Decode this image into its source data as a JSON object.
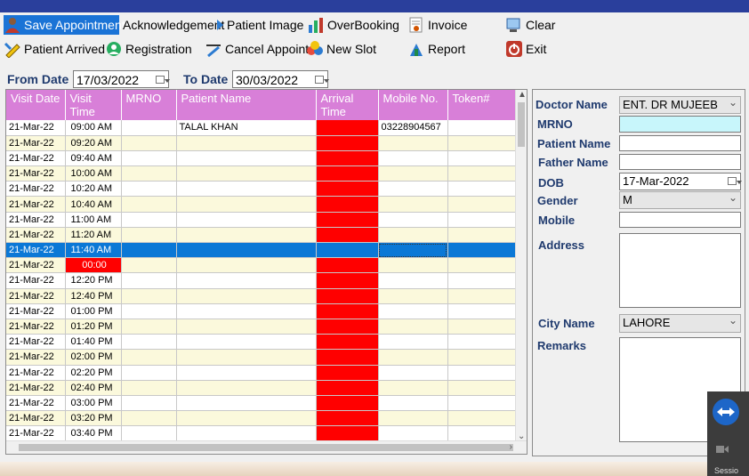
{
  "toolbar": {
    "save_appointment": "Save Appointment",
    "acknowledgement": "Acknowledgement",
    "patient_image": "Patient Image",
    "overbooking": "OverBooking",
    "invoice": "Invoice",
    "clear": "Clear",
    "patient_arrived": "Patient Arrived",
    "registration": "Registration",
    "cancel_appoint": "Cancel Appoint",
    "new_slot": "New Slot",
    "report": "Report",
    "exit": "Exit"
  },
  "filters": {
    "from_label": "From Date",
    "from_value": "17/03/2022",
    "to_label": "To Date",
    "to_value": "30/03/2022"
  },
  "grid": {
    "columns": [
      "Visit Date",
      "Visit Time",
      "MRNO",
      "Patient Name",
      "Arrival Time",
      "Mobile No.",
      "Token#"
    ],
    "rows": [
      {
        "date": "21-Mar-22",
        "time": "09:00 AM",
        "mrno": "",
        "name": "TALAL KHAN",
        "arrival": "",
        "mobile": "03228904567",
        "token": ""
      },
      {
        "date": "21-Mar-22",
        "time": "09:20 AM",
        "mrno": "",
        "name": "",
        "arrival": "",
        "mobile": "",
        "token": ""
      },
      {
        "date": "21-Mar-22",
        "time": "09:40 AM",
        "mrno": "",
        "name": "",
        "arrival": "",
        "mobile": "",
        "token": ""
      },
      {
        "date": "21-Mar-22",
        "time": "10:00 AM",
        "mrno": "",
        "name": "",
        "arrival": "",
        "mobile": "",
        "token": ""
      },
      {
        "date": "21-Mar-22",
        "time": "10:20 AM",
        "mrno": "",
        "name": "",
        "arrival": "",
        "mobile": "",
        "token": ""
      },
      {
        "date": "21-Mar-22",
        "time": "10:40 AM",
        "mrno": "",
        "name": "",
        "arrival": "",
        "mobile": "",
        "token": ""
      },
      {
        "date": "21-Mar-22",
        "time": "11:00 AM",
        "mrno": "",
        "name": "",
        "arrival": "",
        "mobile": "",
        "token": ""
      },
      {
        "date": "21-Mar-22",
        "time": "11:20 AM",
        "mrno": "",
        "name": "",
        "arrival": "",
        "mobile": "",
        "token": ""
      },
      {
        "date": "21-Mar-22",
        "time": "11:40 AM",
        "mrno": "",
        "name": "",
        "arrival": "",
        "mobile": "",
        "token": ""
      },
      {
        "date": "21-Mar-22",
        "time": "00:00",
        "mrno": "",
        "name": "",
        "arrival": "",
        "mobile": "",
        "token": ""
      },
      {
        "date": "21-Mar-22",
        "time": "12:20 PM",
        "mrno": "",
        "name": "",
        "arrival": "",
        "mobile": "",
        "token": ""
      },
      {
        "date": "21-Mar-22",
        "time": "12:40 PM",
        "mrno": "",
        "name": "",
        "arrival": "",
        "mobile": "",
        "token": ""
      },
      {
        "date": "21-Mar-22",
        "time": "01:00 PM",
        "mrno": "",
        "name": "",
        "arrival": "",
        "mobile": "",
        "token": ""
      },
      {
        "date": "21-Mar-22",
        "time": "01:20 PM",
        "mrno": "",
        "name": "",
        "arrival": "",
        "mobile": "",
        "token": ""
      },
      {
        "date": "21-Mar-22",
        "time": "01:40 PM",
        "mrno": "",
        "name": "",
        "arrival": "",
        "mobile": "",
        "token": ""
      },
      {
        "date": "21-Mar-22",
        "time": "02:00 PM",
        "mrno": "",
        "name": "",
        "arrival": "",
        "mobile": "",
        "token": ""
      },
      {
        "date": "21-Mar-22",
        "time": "02:20 PM",
        "mrno": "",
        "name": "",
        "arrival": "",
        "mobile": "",
        "token": ""
      },
      {
        "date": "21-Mar-22",
        "time": "02:40 PM",
        "mrno": "",
        "name": "",
        "arrival": "",
        "mobile": "",
        "token": ""
      },
      {
        "date": "21-Mar-22",
        "time": "03:00 PM",
        "mrno": "",
        "name": "",
        "arrival": "",
        "mobile": "",
        "token": ""
      },
      {
        "date": "21-Mar-22",
        "time": "03:20 PM",
        "mrno": "",
        "name": "",
        "arrival": "",
        "mobile": "",
        "token": ""
      },
      {
        "date": "21-Mar-22",
        "time": "03:40 PM",
        "mrno": "",
        "name": "",
        "arrival": "",
        "mobile": "",
        "token": ""
      }
    ],
    "selected_row": 8,
    "red_time_row": 9
  },
  "form": {
    "doctor_label": "Doctor Name",
    "doctor_value": "ENT. DR MUJEEB",
    "mrno_label": "MRNO",
    "mrno_value": "",
    "patient_label": "Patient Name",
    "patient_value": "",
    "father_label": "Father Name",
    "father_value": "",
    "dob_label": "DOB",
    "dob_value": "17-Mar-2022",
    "gender_label": "Gender",
    "gender_value": "M",
    "mobile_label": "Mobile",
    "mobile_value": "",
    "address_label": "Address",
    "address_value": "",
    "city_label": "City Name",
    "city_value": "LAHORE",
    "remarks_label": "Remarks",
    "remarks_value": ""
  },
  "overlay": {
    "session_text": "Sessio"
  },
  "colors": {
    "header_bg": "#d87fd8",
    "alt_row": "#fbf9dc",
    "arrival_red": "#ff0000",
    "selected_row": "#0b78d6",
    "label_blue": "#1f3a6e"
  }
}
